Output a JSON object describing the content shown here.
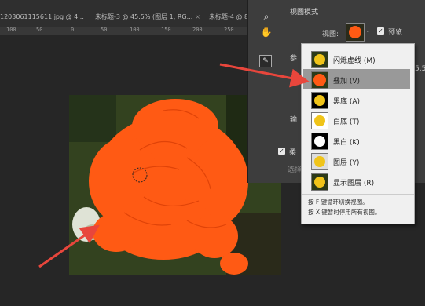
{
  "tabs": [
    {
      "label": "1203061115611.jpg @ 4...",
      "close": "×"
    },
    {
      "label": "未标题-3 @ 45.5% (图层 1, RG...",
      "close": "×"
    },
    {
      "label": "未标题-4 @ 8",
      "close": ""
    }
  ],
  "ruler": {
    "marks": [
      "100",
      "50",
      "0",
      "50",
      "100",
      "150",
      "200",
      "250"
    ]
  },
  "panel": {
    "view_section_title": "视图模式",
    "view_label": "视图:",
    "preview_label": "预览",
    "params_partial": "参",
    "output_partial": "输",
    "checkbox_partial": "柔",
    "select_partial": "选择",
    "side_value_partial": "5.50",
    "tool_icons": [
      "zoom-icon",
      "hand-icon",
      "refine-brush-icon"
    ]
  },
  "view_menu": {
    "items": [
      {
        "label": "闪烁虚线 (M)",
        "thumb": "yellow"
      },
      {
        "label": "叠加 (V)",
        "thumb": "orange"
      },
      {
        "label": "黑底 (A)",
        "thumb": "yellow-on-black"
      },
      {
        "label": "白底 (T)",
        "thumb": "yellow-on-white"
      },
      {
        "label": "黑白 (K)",
        "thumb": "white-mask"
      },
      {
        "label": "图层 (Y)",
        "thumb": "yellow-on-white"
      },
      {
        "label": "显示图层 (R)",
        "thumb": "yellow"
      }
    ],
    "selected_index": 1,
    "notes": [
      "按 F 键循环切换视图。",
      "按 X 键暂时停用所有视图。"
    ]
  },
  "colors": {
    "overlay": "#ff5a14",
    "arrow": "#e8463c",
    "menu_bg": "#f0f0f0"
  }
}
